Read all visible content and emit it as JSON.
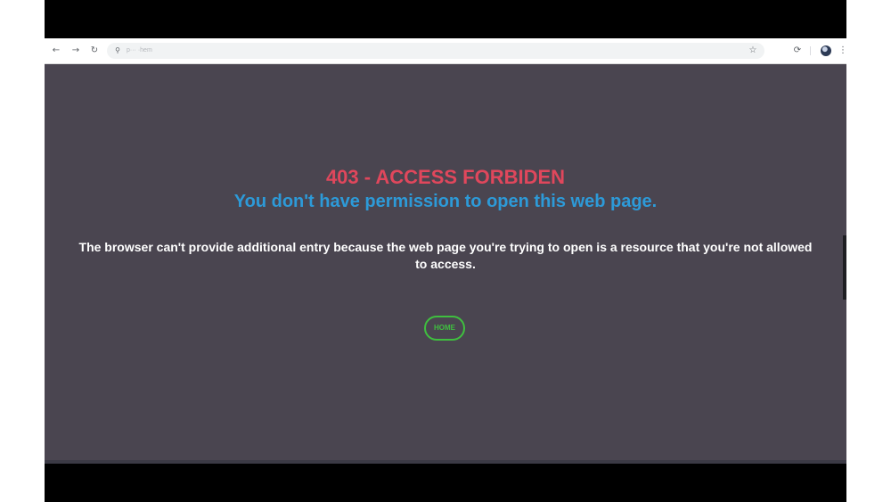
{
  "browser": {
    "back_icon": "←",
    "forward_icon": "→",
    "reload_icon": "↻",
    "site_info_icon": "⚲",
    "url": "p··· ·hem",
    "bookmark_icon": "☆",
    "extension_icon": "⟳",
    "menu_icon": "⋮"
  },
  "error_page": {
    "title": "403 - ACCESS FORBIDEN",
    "subtitle": "You don't have permission to open this web page.",
    "description": "The browser can't provide additional entry because the web page you're trying to open is a resource that you're not allowed to access.",
    "home_button": "HOME"
  },
  "colors": {
    "page_background": "#4a4550",
    "title": "#e0475c",
    "subtitle": "#2d9ad8",
    "description": "#ffffff",
    "home_button": "#3fbf3f"
  }
}
